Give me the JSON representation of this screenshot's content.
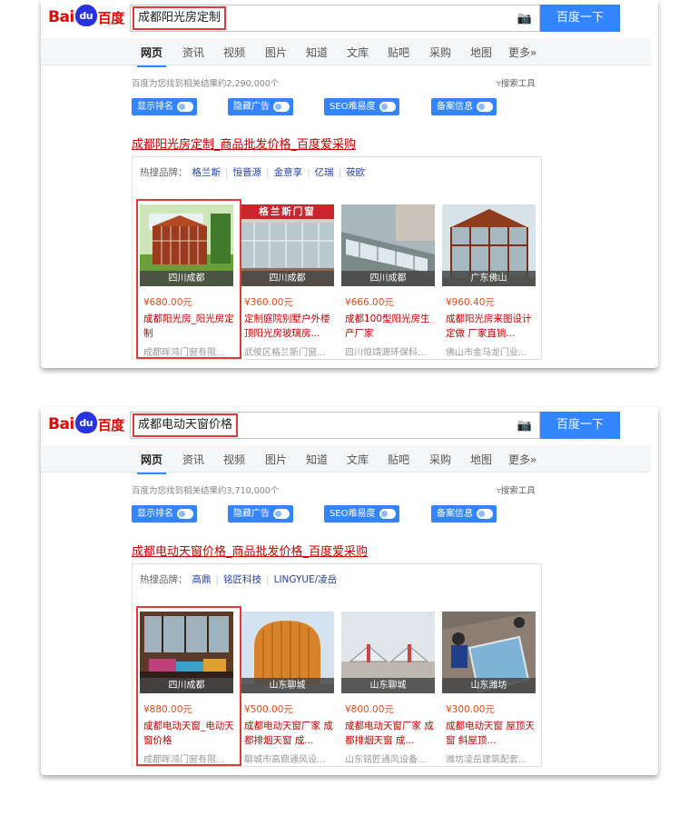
{
  "panels": [
    {
      "query": "成都阳光房定制",
      "search_button": "百度一下",
      "tabs": [
        "网页",
        "资讯",
        "视频",
        "图片",
        "知道",
        "文库",
        "贴吧",
        "采购",
        "地图",
        "更多»"
      ],
      "result_count": "百度为您找到相关结果约2,290,000个",
      "tools": "搜索工具",
      "toggles": [
        "显示排名",
        "隐藏广告",
        "SEO难易度",
        "备案信息"
      ],
      "title": "成都阳光房定制_商品批发价格_百度爱采购",
      "brands_label": "热搜品牌：",
      "brands": [
        "格兰斯",
        "恒晋源",
        "金意享",
        "亿瑞",
        "莜欧"
      ],
      "cards": [
        {
          "location": "四川成都",
          "price": "¥680.00元",
          "name": "成都阳光房_阳光房定制",
          "seller": "成都晖鸿门窗有限..."
        },
        {
          "location": "四川成都",
          "price": "¥360.00元",
          "name": "定制庭院别墅户外楼顶阳光房玻璃房...",
          "seller": "武侯区格兰斯门窗..."
        },
        {
          "location": "四川成都",
          "price": "¥666.00元",
          "name": "成都100型阳光房生产厂家",
          "seller": "四川恒靖源环保科..."
        },
        {
          "location": "广东佛山",
          "price": "¥960.40元",
          "name": "成都阳光房来图设计定做 厂家直销...",
          "seller": "佛山市金马龙门业..."
        }
      ],
      "banner_text": "格兰斯门窗"
    },
    {
      "query": "成都电动天窗价格",
      "search_button": "百度一下",
      "tabs": [
        "网页",
        "资讯",
        "视频",
        "图片",
        "知道",
        "文库",
        "贴吧",
        "采购",
        "地图",
        "更多»"
      ],
      "result_count": "百度为您找到相关结果约3,710,000个",
      "tools": "搜索工具",
      "toggles": [
        "显示排名",
        "隐藏广告",
        "SEO难易度",
        "备案信息"
      ],
      "title": "成都电动天窗价格_商品批发价格_百度爱采购",
      "brands_label": "热搜品牌：",
      "brands": [
        "高鼎",
        "铭匠科技",
        "LINGYUE/凌岳"
      ],
      "cards": [
        {
          "location": "四川成都",
          "price": "¥880.00元",
          "name": "成都电动天窗_电动天窗价格",
          "seller": "成都晖鸿门窗有限..."
        },
        {
          "location": "山东聊城",
          "price": "¥500.00元",
          "name": "成都电动天窗厂家 成都排烟天窗 成...",
          "seller": "聊城市高鼎通风设..."
        },
        {
          "location": "山东聊城",
          "price": "¥800.00元",
          "name": "成都电动天窗厂家 成都排烟天窗 成...",
          "seller": "山东铭匠通风设备..."
        },
        {
          "location": "山东潍坊",
          "price": "¥300.00元",
          "name": "成都电动天窗 屋顶天窗 斜屋顶...",
          "seller": "潍坊凌岳建筑配套..."
        }
      ]
    }
  ],
  "logo": {
    "left": "Bai",
    "paw": "du",
    "right": "百度"
  },
  "icons": {
    "camera": "camera-icon",
    "filter": "filter-icon"
  }
}
